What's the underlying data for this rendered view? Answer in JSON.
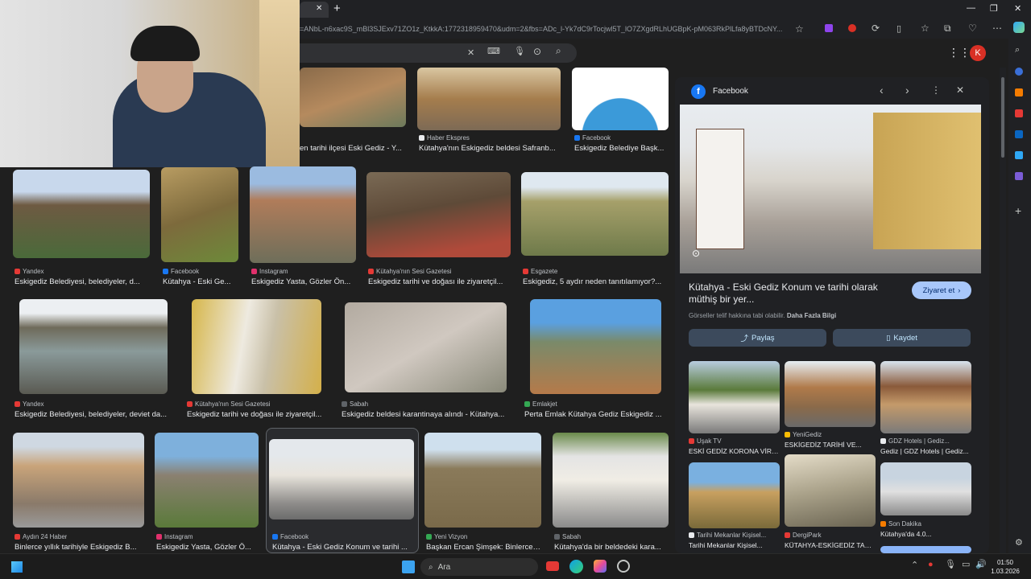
{
  "browser": {
    "url": "=ANbL-n6xac9S_mBl3SJExv71ZO1z_KtkkA:1772318959470&udm=2&fbs=ADc_l-Yk7dC9rTocjwl5T_lO7ZXgdRLhUGBpK-pM063RkPlLfa8yBTDcNY..."
  },
  "search": {
    "close": "✕"
  },
  "results_top": [
    {
      "source": "",
      "caption": "en tarihi ilçesi Eski Gediz - Y..."
    },
    {
      "source": "Haber Ekspres",
      "caption": "Kütahya'nın Eskigediz beldesi Safranb..."
    },
    {
      "source": "Facebook",
      "caption": "Eskigediz Belediye Başk..."
    }
  ],
  "results_row1": [
    {
      "source": "Yandex",
      "caption": "Eskigediz Belediyesi, belediyeler, d..."
    },
    {
      "source": "Facebook",
      "caption": "Kütahya - Eski Ge..."
    },
    {
      "source": "Instagram",
      "caption": "Eskigediz Yasta, Gözler Ön..."
    },
    {
      "source": "Kütahya'nın Sesi Gazetesi",
      "caption": "Eskigediz tarihi ve doğası ile ziyaretçil..."
    },
    {
      "source": "Esgazete",
      "caption": "Eskigediz, 5 aydır neden tanıtılamıyor?..."
    }
  ],
  "results_row2": [
    {
      "source": "Yandex",
      "caption": "Eskigediz Belediyesi, belediyeler, deviet da..."
    },
    {
      "source": "Kütahya'nın Sesi Gazetesi",
      "caption": "Eskigediz tarihi ve doğası ile ziyaretçil..."
    },
    {
      "source": "Sabah",
      "caption": "Eskigediz beldesi karantinaya alındı - Kütahya..."
    },
    {
      "source": "Emlakjet",
      "caption": "Perta Emlak Kütahya Gediz Eskigediz ..."
    }
  ],
  "results_row3": [
    {
      "source": "Aydın 24 Haber",
      "caption": "Binlerce yıllık tarihiyle Eskigediz B..."
    },
    {
      "source": "Instagram",
      "caption": "Eskigediz Yasta, Gözler Ö..."
    },
    {
      "source": "Facebook",
      "caption": "Kütahya - Eski Gediz Konum ve tarihi ..."
    },
    {
      "source": "Yeni Vizyon",
      "caption": "Başkan Ercan Şimşek: Binlerce ..."
    },
    {
      "source": "Sabah",
      "caption": "Kütahya'da bir beldedeki kara..."
    }
  ],
  "panel": {
    "source": "Facebook",
    "title": "Kütahya - Eski Gediz Konum ve tarihi olarak müthiş bir yer...",
    "visit_label": "Ziyaret et",
    "copyright": "Görseller telif hakkına tabi olabilir.",
    "more_info": "Daha Fazla Bilgi",
    "share_label": "Paylaş",
    "save_label": "Kaydet",
    "related": [
      {
        "source": "Uşak TV",
        "caption": "ESKİ GEDİZ KORONA VİRÜS..."
      },
      {
        "source": "YeniGediz",
        "caption": "ESKİGEDİZ TARİHİ VE..."
      },
      {
        "source": "GDZ Hotels | Gediz...",
        "caption": "Gediz | GDZ Hotels | Gediz..."
      },
      {
        "source": "Tarihi Mekanlar Kişisel...",
        "caption": "Tarihi Mekanlar Kişisel..."
      },
      {
        "source": "DergiPark",
        "caption": "KÜTAHYA-ESKİGEDİZ TARİH..."
      },
      {
        "source": "Son Dakika",
        "caption": "Kütahya'da 4.0..."
      }
    ]
  },
  "profile_initial": "K",
  "taskbar": {
    "search_placeholder": "Ara",
    "time": "01:50",
    "date": "1.03.2026"
  },
  "colors": {
    "accent": "#8ab4f8",
    "avatar": "#d93025",
    "facebook": "#1877f2",
    "instagram": "#e1306c"
  }
}
